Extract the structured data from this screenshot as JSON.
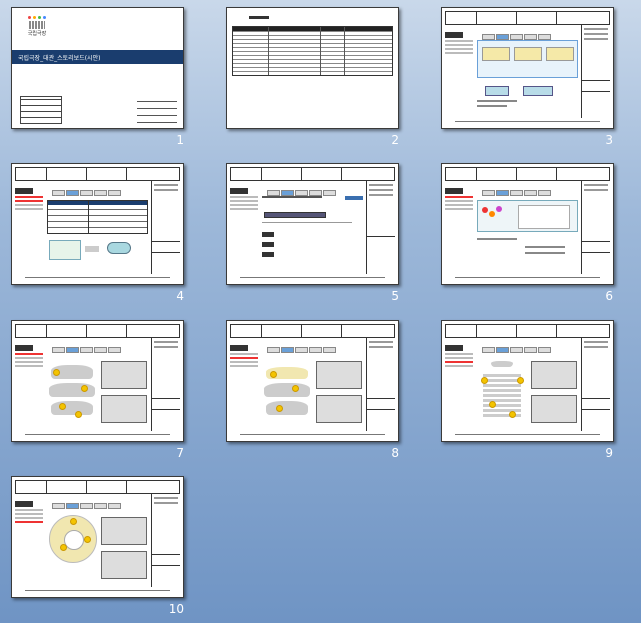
{
  "slides": [
    {
      "number": "1",
      "title": "국립극장_대관_스토리보드(시안)",
      "logo": "국립극장"
    },
    {
      "number": "2"
    },
    {
      "number": "3"
    },
    {
      "number": "4"
    },
    {
      "number": "5"
    },
    {
      "number": "6"
    },
    {
      "number": "7"
    },
    {
      "number": "8"
    },
    {
      "number": "9"
    },
    {
      "number": "10"
    }
  ],
  "colors": {
    "background_top": "#c9d8ea",
    "background_bottom": "#6f94c4",
    "title_bar": "#1a3d6e",
    "accent_yellow": "#f4c400",
    "accent_red": "#e33333"
  }
}
